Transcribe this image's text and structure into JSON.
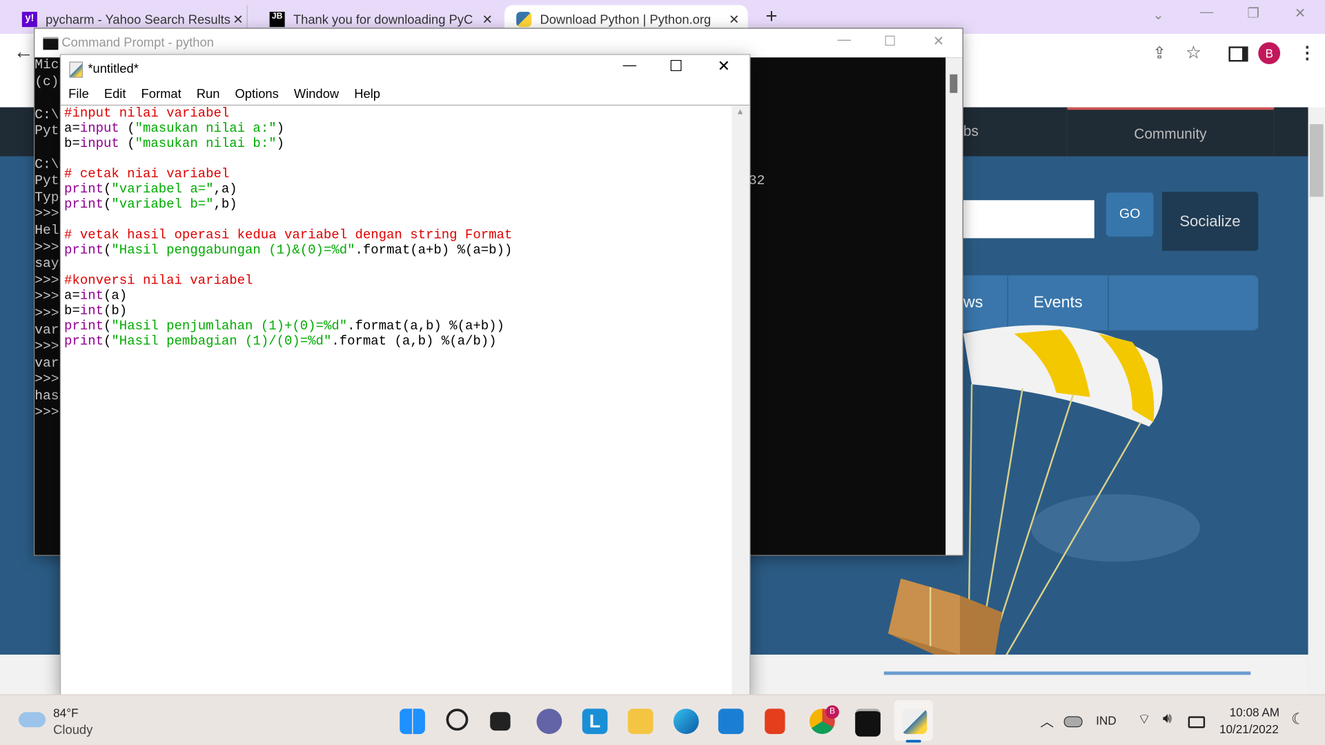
{
  "browser": {
    "tabs": [
      {
        "label": "pycharm - Yahoo Search Results",
        "icon": "yahoo-icon",
        "active": false
      },
      {
        "label": "Thank you for downloading PyCh",
        "icon": "jetbrains-icon",
        "active": false
      },
      {
        "label": "Download Python | Python.org",
        "icon": "python-icon",
        "active": true
      }
    ],
    "new_tab": "+",
    "close_glyph": "✕",
    "avatar_letter": "B",
    "accent": "#c2185b"
  },
  "python_page": {
    "nav_partial": "bs",
    "community": "Community",
    "go": "GO",
    "socialize": "Socialize",
    "news_partial": "ws",
    "events": "Events"
  },
  "cmd": {
    "title": "Command Prompt - python",
    "lines": [
      "Micr",
      "(c)",
      "",
      "C:\\U",
      "Pyth",
      "",
      "C:\\U",
      "Pyth",
      "Type",
      ">>>",
      "Hell",
      ">>>",
      "saya",
      ">>>",
      ">>>",
      ">>>",
      "vari",
      ">>>",
      "vari",
      ">>>",
      "hasi",
      ">>>"
    ],
    "right_fragment": "32"
  },
  "idle": {
    "title": "*untitled*",
    "menu": [
      "File",
      "Edit",
      "Format",
      "Run",
      "Options",
      "Window",
      "Help"
    ],
    "code": [
      [
        [
          "comment",
          "#input nilai variabel"
        ]
      ],
      [
        [
          "plain",
          "a="
        ],
        [
          "kw",
          "input"
        ],
        [
          "plain",
          " ("
        ],
        [
          "str",
          "\"masukan nilai a:\""
        ],
        [
          "plain",
          ")"
        ]
      ],
      [
        [
          "plain",
          "b="
        ],
        [
          "kw",
          "input"
        ],
        [
          "plain",
          " ("
        ],
        [
          "str",
          "\"masukan nilai b:\""
        ],
        [
          "plain",
          ")"
        ]
      ],
      [],
      [
        [
          "comment",
          "# cetak niai variabel"
        ]
      ],
      [
        [
          "kw",
          "print"
        ],
        [
          "plain",
          "("
        ],
        [
          "str",
          "\"variabel a=\""
        ],
        [
          "plain",
          ",a)"
        ]
      ],
      [
        [
          "kw",
          "print"
        ],
        [
          "plain",
          "("
        ],
        [
          "str",
          "\"variabel b=\""
        ],
        [
          "plain",
          ",b)"
        ]
      ],
      [],
      [
        [
          "comment",
          "# vetak hasil operasi kedua variabel dengan string Format"
        ]
      ],
      [
        [
          "kw",
          "print"
        ],
        [
          "plain",
          "("
        ],
        [
          "str",
          "\"Hasil penggabungan (1)&(0)=%d\""
        ],
        [
          "plain",
          ".format(a+b) %(a=b))"
        ]
      ],
      [],
      [
        [
          "comment",
          "#konversi nilai variabel"
        ]
      ],
      [
        [
          "plain",
          "a="
        ],
        [
          "kw",
          "int"
        ],
        [
          "plain",
          "(a)"
        ]
      ],
      [
        [
          "plain",
          "b="
        ],
        [
          "kw",
          "int"
        ],
        [
          "plain",
          "(b)"
        ]
      ],
      [
        [
          "kw",
          "print"
        ],
        [
          "plain",
          "("
        ],
        [
          "str",
          "\"Hasil penjumlahan (1)+(0)=%d\""
        ],
        [
          "plain",
          ".format(a,b) %(a+b))"
        ]
      ],
      [
        [
          "kw",
          "print"
        ],
        [
          "plain",
          "("
        ],
        [
          "str",
          "\"Hasil pembagian (1)/(0)=%d\""
        ],
        [
          "plain",
          ".format (a,b) %(a/b))"
        ]
      ]
    ]
  },
  "taskbar": {
    "weather_temp": "84°F",
    "weather_desc": "Cloudy",
    "language": "IND",
    "time": "10:08 AM",
    "date": "10/21/2022",
    "chrome_badge": "B"
  }
}
